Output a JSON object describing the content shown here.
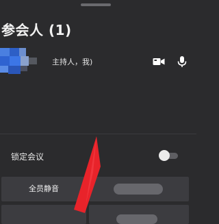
{
  "panel": {
    "title": "参会人 (1)"
  },
  "participant": {
    "role_text": "主持人，我)",
    "video_icon": "video-camera-icon",
    "mic_icon": "microphone-icon"
  },
  "settings": {
    "lock_meeting_label": "锁定会议",
    "lock_meeting_enabled": false
  },
  "actions": {
    "mute_all_label": "全员静音"
  },
  "colors": {
    "background": "#2b2b2d",
    "button_bg": "#3c3c40",
    "arrow": "#e8232a",
    "avatar_blue": "#3e72d8"
  }
}
